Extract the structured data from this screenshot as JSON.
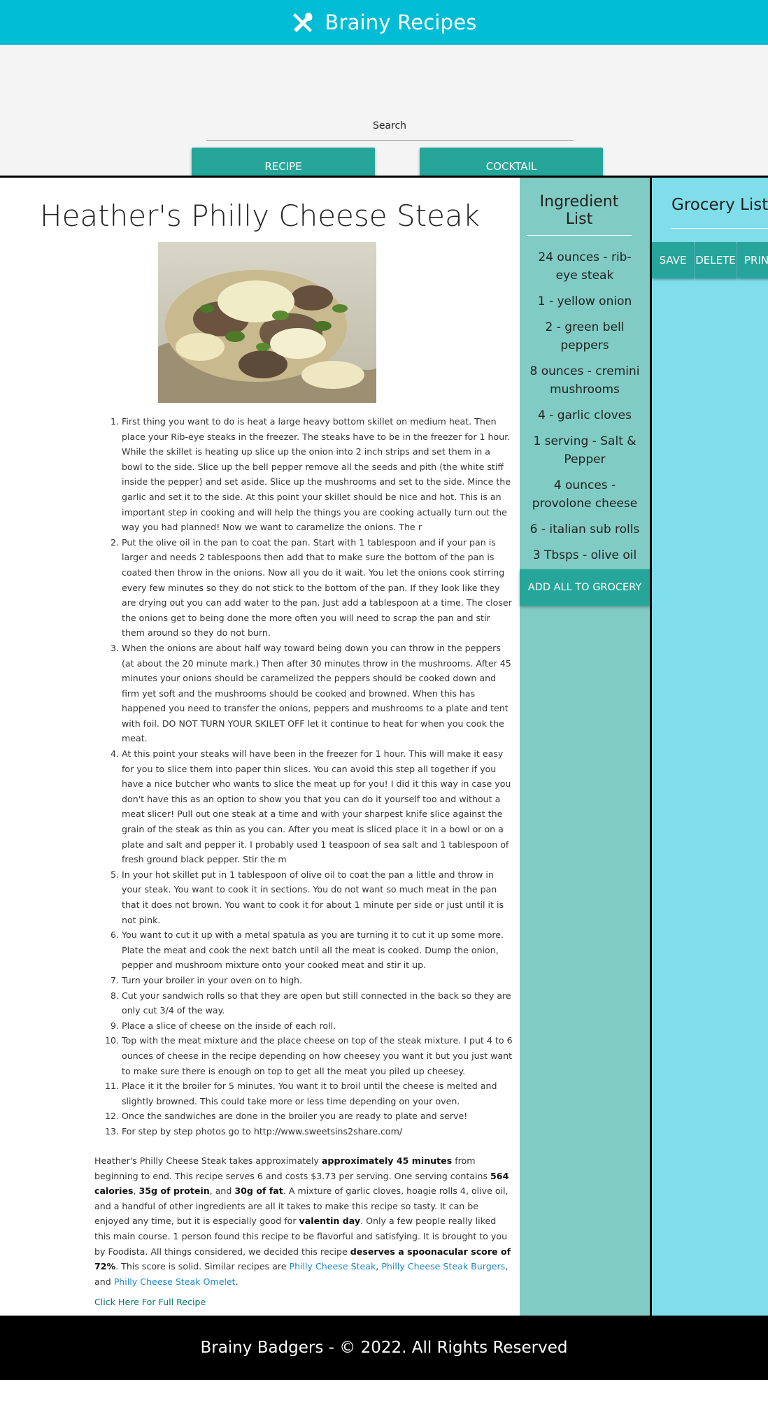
{
  "header": {
    "app_title": "Brainy Recipes",
    "logo_icon": "utensils-icon"
  },
  "search": {
    "label": "Search",
    "recipe_button": "RECIPE",
    "cocktail_button": "COCKTAIL"
  },
  "recipe": {
    "title": "Heather's Philly Cheese Steak",
    "steps": [
      "First thing you want to do is heat a large heavy bottom skillet on medium heat. Then place your Rib-eye steaks in the freezer. The steaks have to be in the freezer for 1 hour. While the skillet is heating up slice up the onion into 2 inch strips and set them in a bowl to the side. Slice up the bell pepper remove all the seeds and pith (the white stiff inside the pepper) and set aside. Slice up the mushrooms and set to the side. Mince the garlic and set it to the side. At this point your skillet should be nice and hot. This is an important step in cooking and will help the things you are cooking actually turn out the way you had planned! Now we want to caramelize the onions. The r",
      "Put the olive oil in the pan to coat the pan. Start with 1 tablespoon and if your pan is larger and needs 2 tablespoons then add that to make sure the bottom of the pan is coated then throw in the onions. Now all you do it wait. You let the onions cook stirring every few minutes so they do not stick to the bottom of the pan. If they look like they are drying out you can add water to the pan. Just add a tablespoon at a time. The closer the onions get to being done the more often you will need to scrap the pan and stir them around so they do not burn.",
      "When the onions are about half way toward being down you can throw in the peppers (at about the 20 minute mark.) Then after 30 minutes throw in the mushrooms. After 45 minutes your onions should be caramelized the peppers should be cooked down and firm yet soft and the mushrooms should be cooked and browned. When this has happened you need to transfer the onions, peppers and mushrooms to a plate and tent with foil. DO NOT TURN YOUR SKILET OFF let it continue to heat for when you cook the meat.",
      "At this point your steaks will have been in the freezer for 1 hour. This will make it easy for you to slice them into paper thin slices. You can avoid this step all together if you have a nice butcher who wants to slice the meat up for you! I did it this way in case you don't have this as an option to show you that you can do it yourself too and without a meat slicer! Pull out one steak at a time and with your sharpest knife slice against the grain of the steak as thin as you can. After you meat is sliced place it in a bowl or on a plate and salt and pepper it. I probably used 1 teaspoon of sea salt and 1 tablespoon of fresh ground black pepper. Stir the m",
      "In your hot skillet put in 1 tablespoon of olive oil to coat the pan a little and throw in your steak. You want to cook it in sections. You do not want so much meat in the pan that it does not brown. You want to cook it for about 1 minute per side or just until it is not pink.",
      "You want to cut it up with a metal spatula as you are turning it to cut it up some more. Plate the meat and cook the next batch until all the meat is cooked. Dump the onion, pepper and mushroom mixture onto your cooked meat and stir it up.",
      "Turn your broiler in your oven on to high.",
      "Cut your sandwich rolls so that they are open but still connected in the back so they are only cut 3/4 of the way.",
      "Place a slice of cheese on the inside of each roll.",
      "Top with the meat mixture and the place cheese on top of the steak mixture. I put 4 to 6 ounces of cheese in the recipe depending on how cheesey you want it but you just want to make sure there is enough on top to get all the meat you piled up cheesey.",
      "Place it it the broiler for 5 minutes. You want it to broil until the cheese is melted and slightly browned. This could take more or less time depending on your oven.",
      "Once the sandwiches are done in the broiler you are ready to plate and serve!",
      "For step by step photos go to http://www.sweetsins2share.com/"
    ],
    "summary": {
      "t1": "Heather's Philly Cheese Steak takes approximately ",
      "b1": "approximately 45 minutes",
      "t2": " from beginning to end. This recipe serves 6 and costs $3.73 per serving. One serving contains ",
      "b2": "564 calories",
      "t3": ", ",
      "b3": "35g of protein",
      "t4": ", and ",
      "b4": "30g of fat",
      "t5": ". A mixture of garlic cloves, hoagie rolls 4, olive oil, and a handful of other ingredients are all it takes to make this recipe so tasty. It can be enjoyed any time, but it is especially good for ",
      "b5": "valentin day",
      "t6": ". Only a few people really liked this main course. 1 person found this recipe to be flavorful and satisfying. It is brought to you by Foodista. All things considered, we decided this recipe ",
      "b6": "deserves a spoonacular score of 72%",
      "t7": ". This score is solid. Similar recipes are ",
      "l1": "Philly Cheese Steak",
      "t8": ", ",
      "l2": "Philly Cheese Steak Burgers",
      "t9": ", and ",
      "l3": "Philly Cheese Steak Omelet",
      "t10": "."
    },
    "full_recipe_link": "Click Here For Full Recipe"
  },
  "ingredients": {
    "title": "Ingredient List",
    "items": [
      "24 ounces - rib-eye steak",
      "1 - yellow onion",
      "2 - green bell peppers",
      "8 ounces - cremini mushrooms",
      "4 - garlic cloves",
      "1 serving - Salt & Pepper",
      "4 ounces - provolone cheese",
      "6 - italian sub rolls",
      "3 Tbsps - olive oil"
    ],
    "add_all_button": "ADD ALL TO GROCERY"
  },
  "grocery": {
    "title": "Grocery List",
    "save_button": "SAVE",
    "delete_button": "DELETE",
    "print_button": "PRINT"
  },
  "footer": {
    "text": "Brainy Badgers - © 2022. All Rights Reserved"
  },
  "colors": {
    "header": "#00bcd4",
    "button": "#26a69a",
    "ingredient_panel": "#80cbc4",
    "grocery_panel": "#80deea",
    "footer": "#000000"
  }
}
